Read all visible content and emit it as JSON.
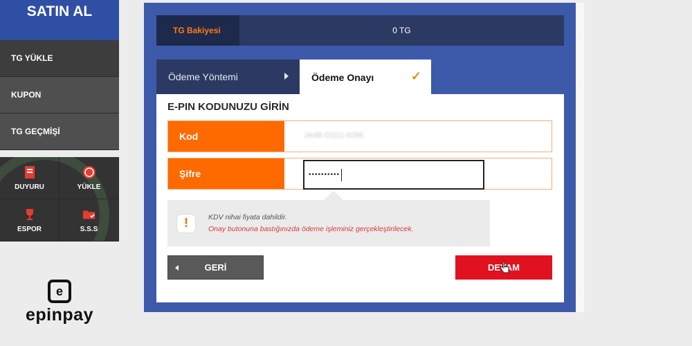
{
  "sidebar": {
    "title": "SATIN AL",
    "menu": [
      {
        "label": "TG YÜKLE"
      },
      {
        "label": "KUPON"
      },
      {
        "label": "TG GEÇMİŞİ"
      }
    ],
    "grid": [
      {
        "label": "DUYURU",
        "icon": "announcement-icon"
      },
      {
        "label": "YÜKLE",
        "icon": "coin-icon"
      },
      {
        "label": "ESPOR",
        "icon": "trophy-icon"
      },
      {
        "label": "S.S.S",
        "icon": "folder-check-icon"
      }
    ]
  },
  "brand": {
    "logo_text": "epinpay",
    "mark": "e"
  },
  "balance": {
    "label": "TG Bakiyesi",
    "value": "0 TG"
  },
  "tabs": [
    {
      "label": "Ödeme Yöntemi"
    },
    {
      "label": "Ödeme Onayı"
    }
  ],
  "form": {
    "heading": "E-PIN KODUNUZU GİRİN",
    "kod_label": "Kod",
    "kod_value": "JA4B-D1D1-8286",
    "sifre_label": "Şifre",
    "sifre_value": "••••••••••"
  },
  "notice": {
    "line1": "KDV nihai fiyata dahildir.",
    "line2": "Onay butonuna bastığınızda ödeme işleminiz gerçekleştirilecek."
  },
  "buttons": {
    "back": "GERİ",
    "next": "DEVAM"
  },
  "colors": {
    "accent": "#ff6a00",
    "primary": "#3d5aaa",
    "danger": "#e1121f"
  }
}
